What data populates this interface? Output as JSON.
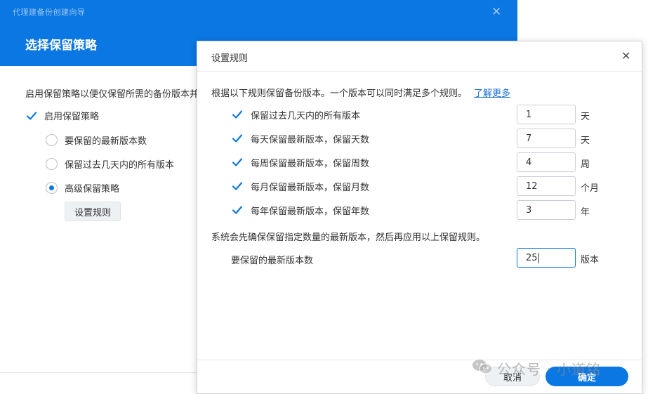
{
  "wizard": {
    "window_title": "代理建备份创建向导",
    "title": "选择保留策略",
    "description": "启用保留策略以便仅保留所需的备份版本并",
    "enable_label": "启用保留策略",
    "options": [
      {
        "label": "要保留的最新版本数",
        "selected": false
      },
      {
        "label": "保留过去几天内的所有版本",
        "selected": false
      },
      {
        "label": "高级保留策略",
        "selected": true
      }
    ],
    "set_rules_button": "设置规则"
  },
  "modal": {
    "title": "设置规则",
    "description": "根据以下规则保留备份版本。一个版本可以同时满足多个规则。",
    "learn_more": "了解更多",
    "rules": [
      {
        "label": "保留过去几天内的所有版本",
        "value": "1",
        "unit": "天",
        "checked": true
      },
      {
        "label": "每天保留最新版本，保留天数",
        "value": "7",
        "unit": "天",
        "checked": true
      },
      {
        "label": "每周保留最新版本，保留周数",
        "value": "4",
        "unit": "周",
        "checked": true
      },
      {
        "label": "每月保留最新版本，保留月数",
        "value": "12",
        "unit": "个月",
        "checked": true
      },
      {
        "label": "每年保留最新版本，保留年数",
        "value": "3",
        "unit": "年",
        "checked": true
      }
    ],
    "note": "系统会先确保保留指定数量的最新版本，然后再应用以上保留规则。",
    "keep_latest": {
      "label": "要保留的最新版本数",
      "value": "25",
      "unit": "版本"
    },
    "cancel_button": "取消",
    "ok_button": "确定"
  },
  "watermark": {
    "text": "公众号 · 小道铭"
  },
  "colors": {
    "accent": "#0a77e3",
    "link": "#1a6fd1"
  }
}
